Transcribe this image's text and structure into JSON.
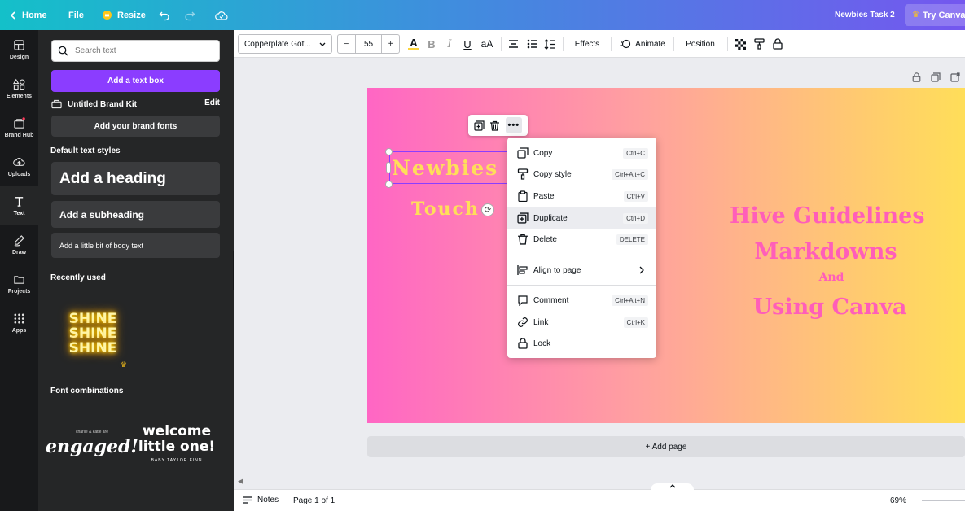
{
  "topbar": {
    "home": "Home",
    "file": "File",
    "resize": "Resize",
    "doc_title": "Newbies Task 2",
    "try_canva": "Try Canva Pro"
  },
  "rail": {
    "items": [
      {
        "label": "Design",
        "icon": "layout-icon"
      },
      {
        "label": "Elements",
        "icon": "shapes-icon"
      },
      {
        "label": "Brand Hub",
        "icon": "brand-icon"
      },
      {
        "label": "Uploads",
        "icon": "upload-icon"
      },
      {
        "label": "Text",
        "icon": "text-icon"
      },
      {
        "label": "Draw",
        "icon": "pen-icon"
      },
      {
        "label": "Projects",
        "icon": "folder-icon"
      },
      {
        "label": "Apps",
        "icon": "grid-icon"
      }
    ]
  },
  "panel": {
    "search_placeholder": "Search text",
    "add_text_box": "Add a text box",
    "brand_kit": "Untitled Brand Kit",
    "brand_edit": "Edit",
    "add_brand_fonts": "Add your brand fonts",
    "default_styles_title": "Default text styles",
    "heading": "Add a heading",
    "subheading": "Add a subheading",
    "body": "Add a little bit of body text",
    "recently_used_title": "Recently used",
    "shine_lines": [
      "SHINE",
      "SHINE",
      "SHINE"
    ],
    "font_combinations_title": "Font combinations",
    "combo1_small": "charlie & katie are",
    "combo1_main": "engaged!",
    "combo2_line1": "welcome",
    "combo2_line2": "little one!",
    "combo2_sub": "BABY TAYLOR FINN"
  },
  "toolbar": {
    "font_name": "Copperplate Got...",
    "font_size": "55",
    "minus": "−",
    "plus": "+",
    "bold": "B",
    "italic": "I",
    "underline": "U",
    "case": "aA",
    "effects": "Effects",
    "animate": "Animate",
    "position": "Position",
    "text_color": "#fbd33a"
  },
  "canvas": {
    "text1": "Newbies",
    "text2": "Touch",
    "hive1": "Hive Guidelines",
    "hive2": "Markdowns",
    "hive3": "And",
    "hive4": "Using Canva",
    "gradient_start": "#ff66c4",
    "gradient_end": "#ffde59"
  },
  "context_menu": {
    "items": [
      {
        "label": "Copy",
        "shortcut": "Ctrl+C"
      },
      {
        "label": "Copy style",
        "shortcut": "Ctrl+Alt+C"
      },
      {
        "label": "Paste",
        "shortcut": "Ctrl+V"
      },
      {
        "label": "Duplicate",
        "shortcut": "Ctrl+D"
      },
      {
        "label": "Delete",
        "shortcut": "DELETE"
      },
      {
        "label": "Align to page",
        "shortcut": ""
      },
      {
        "label": "Comment",
        "shortcut": "Ctrl+Alt+N"
      },
      {
        "label": "Link",
        "shortcut": "Ctrl+K"
      },
      {
        "label": "Lock",
        "shortcut": ""
      }
    ]
  },
  "add_page": "+ Add page",
  "bottombar": {
    "notes": "Notes",
    "page": "Page 1 of 1",
    "zoom": "69%"
  }
}
